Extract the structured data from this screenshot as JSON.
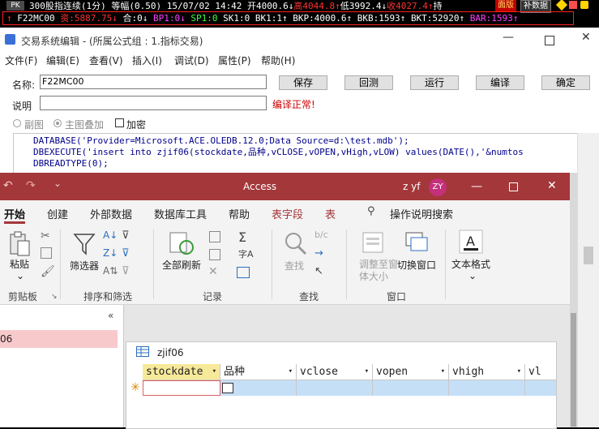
{
  "topbar": {
    "pk_badge": "PK",
    "quote_line": "300股指连续(1分) 等幅(0.50) 15/07/02 14:42 开4000.6↓",
    "high": "高4044.8↑",
    "low": "低3992.4↓",
    "close": "收4027.4↑",
    "trailing_char": "持",
    "btn1_label": "面版",
    "btn2_label": "补数据",
    "arrow_glyph": "↑",
    "symbol": "F22MC00",
    "capital": "资:5887.75↓",
    "pos": "合:0↓",
    "bp1": "BP1:0↓",
    "sp1": "SP1:0",
    "sk1": "SK1:0",
    "bk1": "BK1:1↑",
    "bkp": "BKP:4000.6↑",
    "bkb": "BKB:1593↑",
    "bkt": "BKT:52920↑",
    "bar": "BAR:1593↑"
  },
  "trade_window": {
    "title": "交易系统编辑 - (所属公式组 : 1.指标交易)",
    "menus": [
      "文件(F)",
      "编辑(E)",
      "查看(V)",
      "插入(I)",
      "调试(D)",
      "属性(P)",
      "帮助(H)"
    ],
    "name_label": "名称:",
    "name_value": "F22MC00",
    "desc_label": "说明",
    "desc_value": "",
    "status": "编译正常!",
    "buttons": {
      "save": "保存",
      "reset": "回测",
      "run": "运行",
      "compile": "编译",
      "ok": "确定"
    },
    "options": {
      "sub_chart": "副图",
      "main_overlay": "主图叠加",
      "encrypt": "加密"
    },
    "code_lines": [
      "DATABASE('Provider=Microsoft.ACE.OLEDB.12.0;Data Source=d:\\test.mdb');",
      "   DBEXECUTE('insert into zjif06(stockdate,品种,vCLOSE,vOPEN,vHigh,vLOW) values(DATE(),'&numtos",
      "DBREADTYPE(0);"
    ]
  },
  "access": {
    "title": "Access",
    "user_name": "z yf",
    "user_initials": "ZY",
    "tabs": [
      "开始",
      "创建",
      "外部数据",
      "数据库工具",
      "帮助",
      "表字段",
      "表"
    ],
    "search_label": "操作说明搜索",
    "groups": [
      "剪贴板",
      "排序和筛选",
      "记录",
      "查找",
      "窗口"
    ],
    "ribbon_labels": {
      "paste": "粘贴",
      "filter": "筛选器",
      "refresh_all": "全部刷新",
      "find": "查找",
      "resize": "调整至窗体大小",
      "switch_window": "切换窗口",
      "text_format": "文本格式"
    },
    "nav_item": "06",
    "table_tab": "zjif06",
    "columns": [
      "stockdate",
      "品种",
      "vclose",
      "vopen",
      "vhigh",
      "vl"
    ]
  },
  "colors": {
    "access_title": "#a4373a",
    "accent_tab": "#a4373a",
    "status_red": "#cc0000",
    "grid_row": "#c5dff6",
    "header_sel": "#f7e99a"
  }
}
